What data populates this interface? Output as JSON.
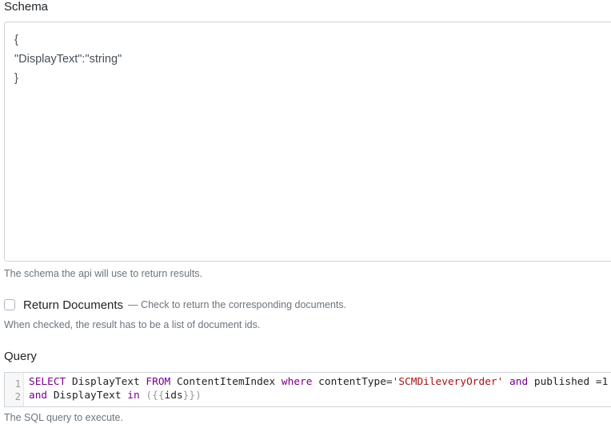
{
  "schema": {
    "label": "Schema",
    "value": "{\n\"DisplayText\":\"string\"\n}",
    "help": "The schema the api will use to return results."
  },
  "return_documents": {
    "label": "Return Documents",
    "hint": "— Check to return the corresponding documents.",
    "checked": false,
    "help": "When checked, the result has to be a list of document ids."
  },
  "query": {
    "label": "Query",
    "line_numbers": [
      "1",
      "2"
    ],
    "line1": {
      "t1": "SELECT",
      "t2": " DisplayText ",
      "t3": "FROM",
      "t4": " ContentItemIndex ",
      "t5": "where",
      "t6": " contentType=",
      "t7": "'SCMDileveryOrder'",
      "t8": " ",
      "t9": "and",
      "t10": " published =1"
    },
    "line2": {
      "t1": "and",
      "t2": " DisplayText ",
      "t3": "in",
      "t4": " ({{",
      "t5": "ids",
      "t6": "}})"
    },
    "help": "The SQL query to execute."
  }
}
